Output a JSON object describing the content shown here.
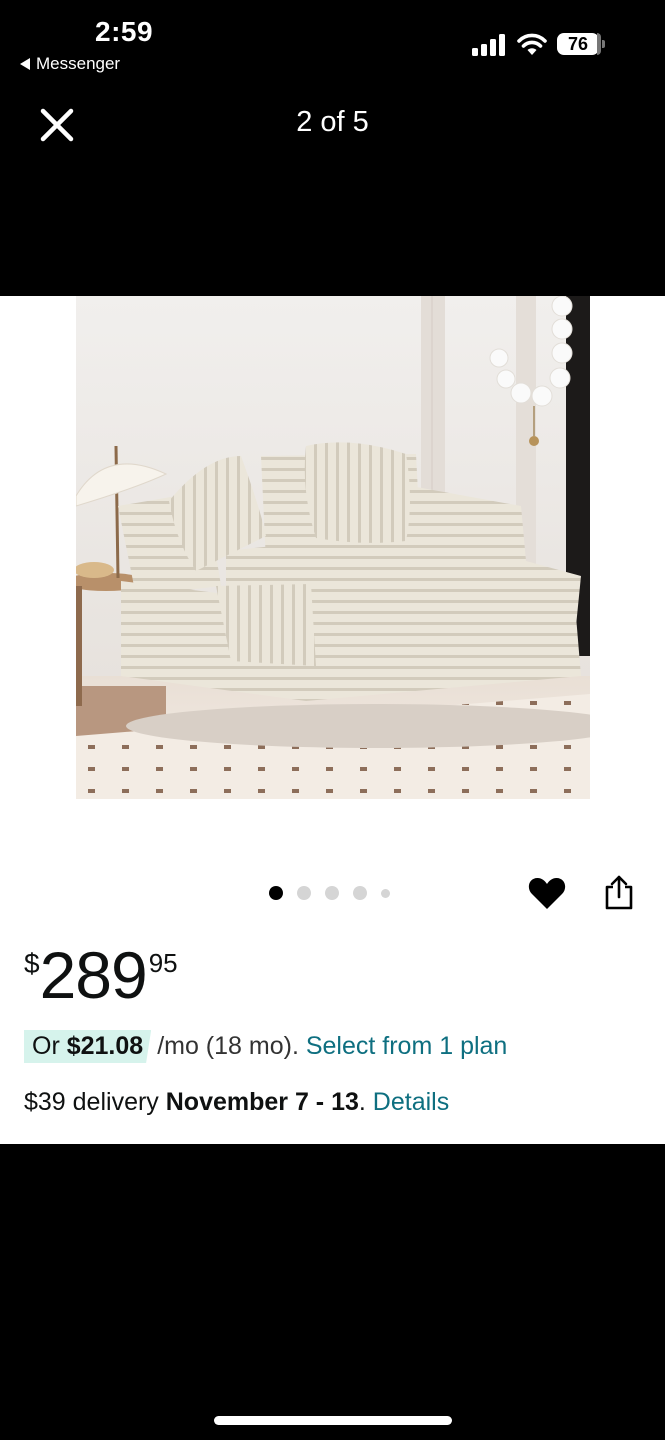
{
  "status_bar": {
    "time": "2:59",
    "back_app": "Messenger",
    "battery": "76"
  },
  "viewer": {
    "counter": "2 of 5",
    "close_icon": "close-icon",
    "pagination": {
      "total_dots": 5,
      "active_index": 0
    }
  },
  "product": {
    "image_alt": "Beige ribbed corduroy chaise lounge with two pillows",
    "price": {
      "currency": "$",
      "whole": "289",
      "fraction": "95"
    },
    "monthly": {
      "prefix": "Or ",
      "amount": "$21.08",
      "term": " /mo (18 mo). ",
      "plan_link": "Select from 1 plan"
    },
    "delivery": {
      "fee": "$39 delivery ",
      "dates": "November 7 - 13",
      "period": ". ",
      "details_link": "Details"
    }
  },
  "colors": {
    "link": "#0e6f80",
    "badge_bg": "#d6f3ec",
    "background": "#000000",
    "card": "#ffffff"
  }
}
